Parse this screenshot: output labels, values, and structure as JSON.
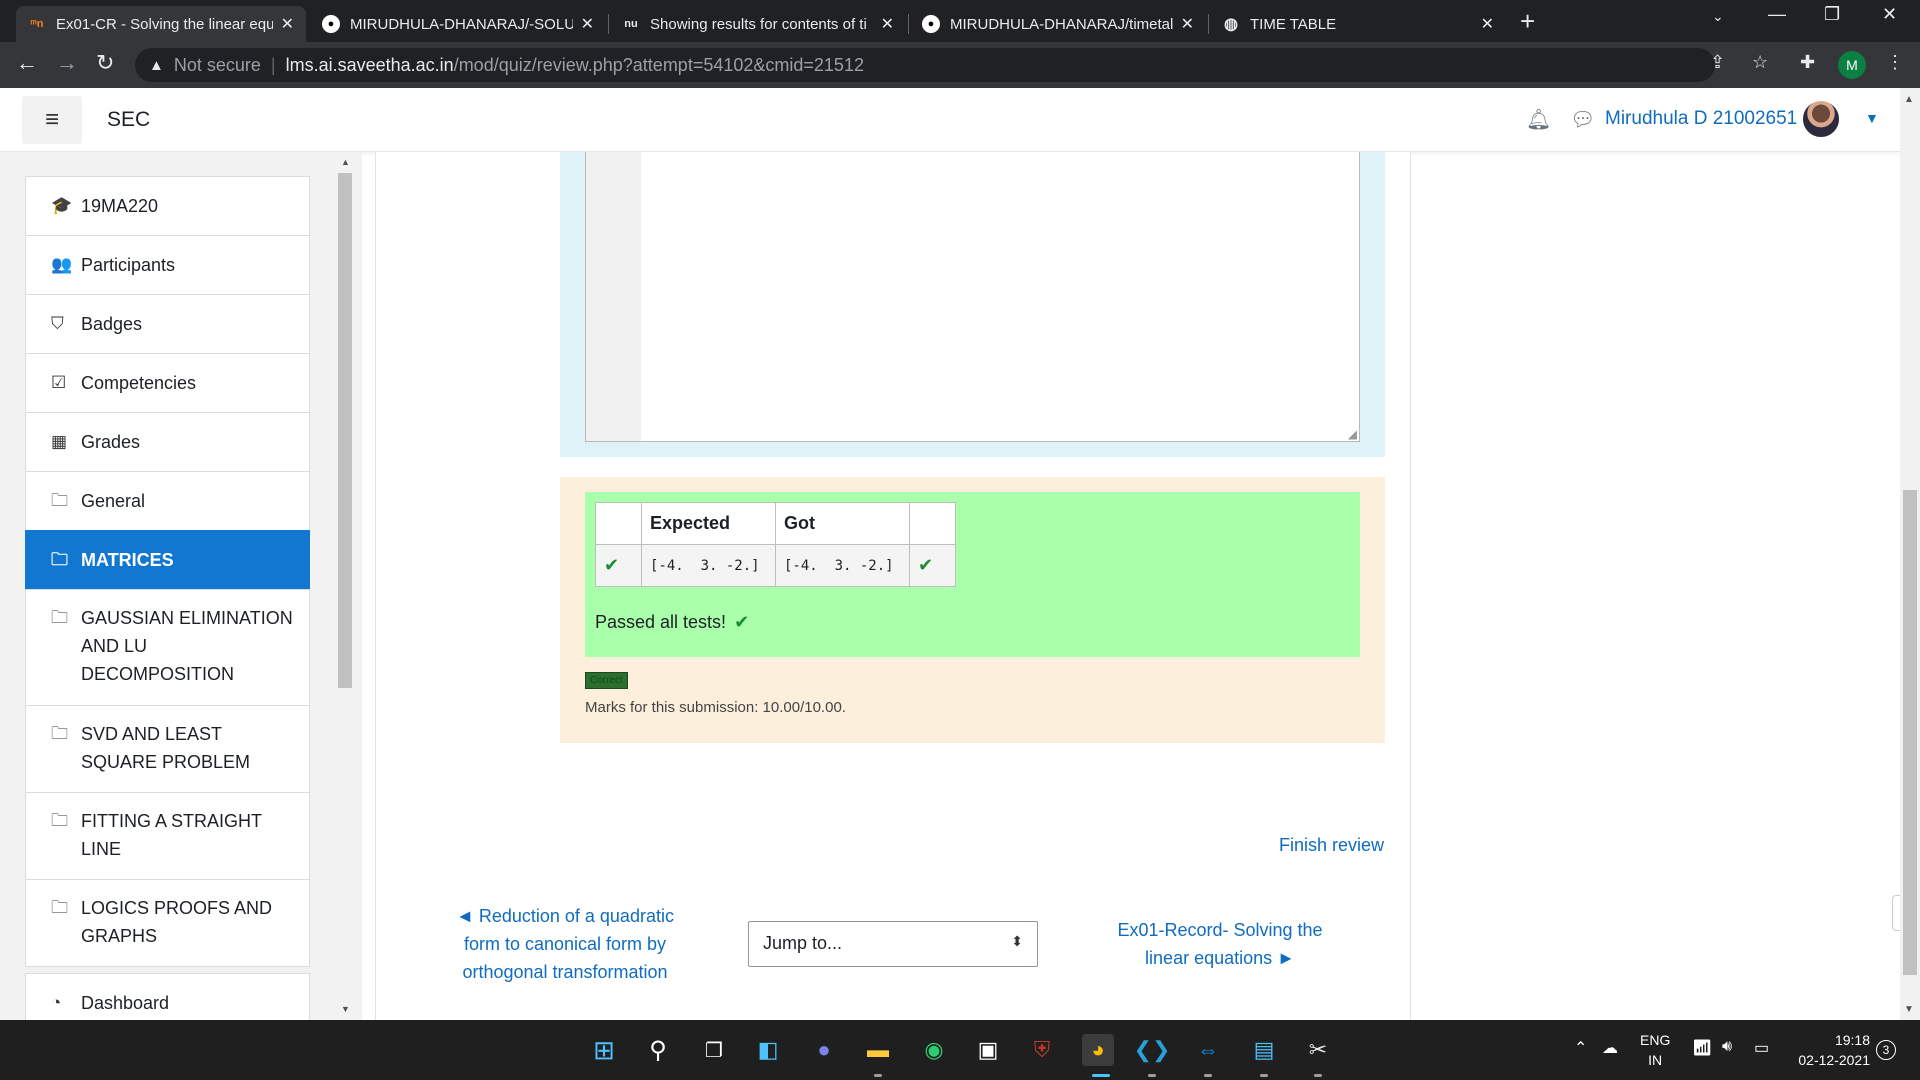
{
  "browser": {
    "tabs": [
      {
        "favicon": "moodle-icon",
        "title": "Ex01-CR - Solving the linear equa",
        "active": true
      },
      {
        "favicon": "github-icon",
        "title": "MIRUDHULA-DHANARAJ/-SOLU",
        "active": false
      },
      {
        "favicon": "nu-icon",
        "title": "Showing results for contents of ti",
        "active": false
      },
      {
        "favicon": "github-icon",
        "title": "MIRUDHULA-DHANARAJ/timetal",
        "active": false
      },
      {
        "favicon": "globe-icon",
        "title": "TIME TABLE",
        "active": false
      }
    ],
    "security_label": "Not secure",
    "url_host": "lms.ai.saveetha.ac.in",
    "url_path": "/mod/quiz/review.php?attempt=54102&cmid=21512",
    "profile_initial": "M"
  },
  "navbar": {
    "site_name": "SEC",
    "user_name": "Mirudhula D 21002651 |"
  },
  "drawer": {
    "items": [
      {
        "icon": "graduation-cap-icon",
        "glyph": "🎓",
        "label": "19MA220"
      },
      {
        "icon": "users-icon",
        "glyph": "👥",
        "label": "Participants"
      },
      {
        "icon": "shield-icon",
        "glyph": "⛉",
        "label": "Badges"
      },
      {
        "icon": "checkbox-icon",
        "glyph": "☑",
        "label": "Competencies"
      },
      {
        "icon": "table-icon",
        "glyph": "▦",
        "label": "Grades"
      },
      {
        "icon": "folder-icon",
        "glyph": "🗀",
        "label": "General"
      },
      {
        "icon": "folder-icon",
        "glyph": "🗀",
        "label": "MATRICES",
        "active": true
      },
      {
        "icon": "folder-icon",
        "glyph": "🗀",
        "label": "GAUSSIAN ELIMINATION AND LU DECOMPOSITION"
      },
      {
        "icon": "folder-icon",
        "glyph": "🗀",
        "label": "SVD AND LEAST SQUARE PROBLEM"
      },
      {
        "icon": "folder-icon",
        "glyph": "🗀",
        "label": "FITTING A STRAIGHT LINE"
      },
      {
        "icon": "folder-icon",
        "glyph": "🗀",
        "label": "LOGICS PROOFS AND GRAPHS"
      },
      {
        "icon": "dashboard-icon",
        "glyph": "◔",
        "label": "Dashboard"
      }
    ]
  },
  "results": {
    "headers": [
      "",
      "Expected",
      "Got",
      ""
    ],
    "rows": [
      {
        "expected": "[-4.  3. -2.]",
        "got": "[-4.  3. -2.]"
      }
    ],
    "passed_text": "Passed all tests!",
    "badge_text": "Correct",
    "marks_text": "Marks for this submission: 10.00/10.00."
  },
  "footer_nav": {
    "finish_review": "Finish review",
    "prev_link": "◄ Reduction of a quadratic form to canonical form by orthogonal transformation",
    "jump_placeholder": "Jump to...",
    "next_link": "Ex01-Record- Solving the linear equations ►"
  },
  "taskbar": {
    "lang_line1": "ENG",
    "lang_line2": "IN",
    "time": "19:18",
    "date": "02-12-2021",
    "notifications": "3"
  }
}
